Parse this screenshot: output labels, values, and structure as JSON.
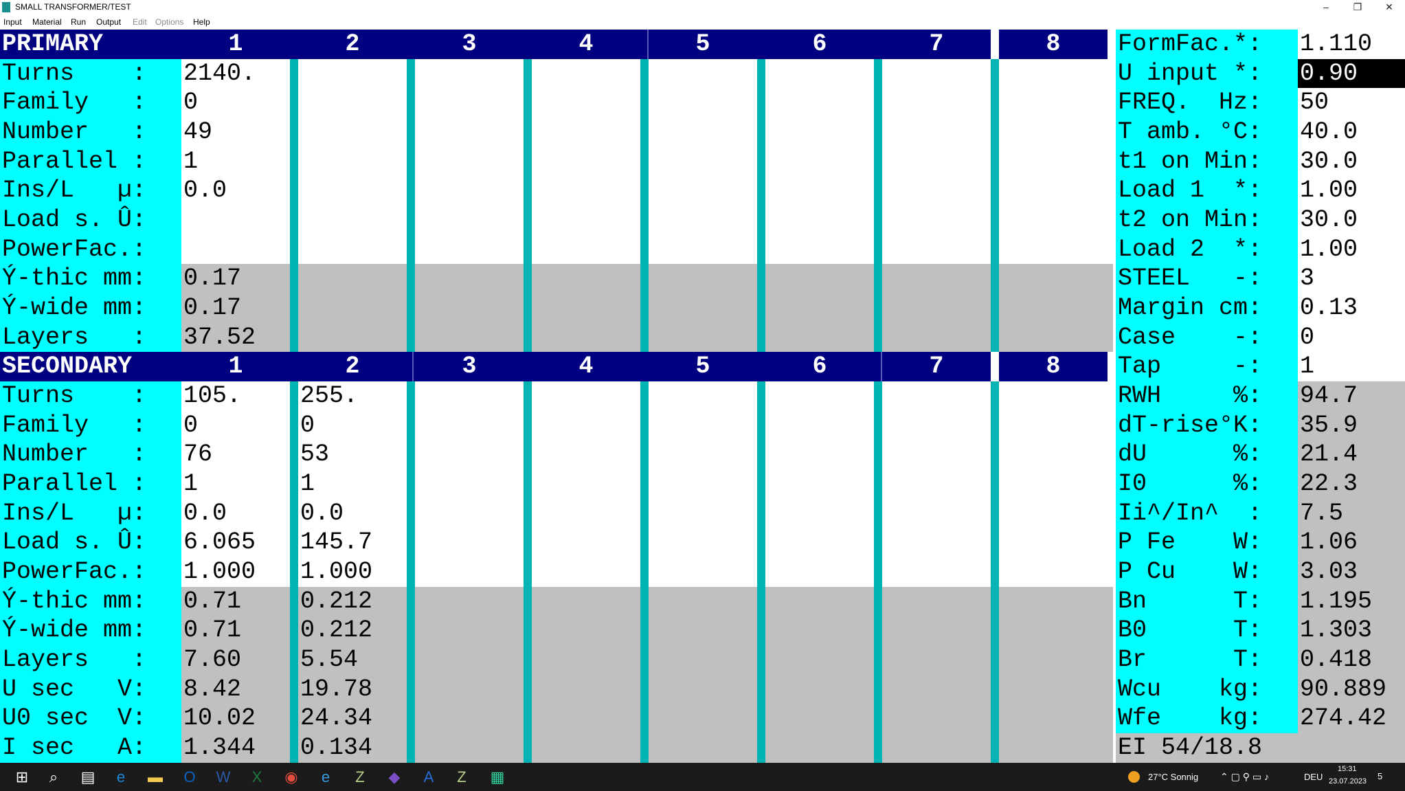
{
  "window": {
    "title": "SMALL TRANSFORMER/TEST",
    "minimize": "–",
    "maximize": "❐",
    "close": "✕"
  },
  "menu": [
    {
      "label": "Input",
      "enabled": true
    },
    {
      "label": "Material",
      "enabled": true
    },
    {
      "label": "Run",
      "enabled": true
    },
    {
      "label": "Output",
      "enabled": true
    },
    {
      "label": "Edit",
      "enabled": false
    },
    {
      "label": "Options",
      "enabled": false
    },
    {
      "label": "Help",
      "enabled": true
    }
  ],
  "primary": {
    "title": "PRIMARY",
    "columns": [
      "1",
      "2",
      "3",
      "4",
      "5",
      "6",
      "7",
      "8"
    ],
    "labels": [
      "Turns    :",
      "Family   :",
      "Number   :",
      "Parallel :",
      "Ins/L   µ:",
      "Load s. Û:",
      "PowerFac.:",
      "Ý-thic mm:",
      "Ý-wide mm:",
      "Layers   :"
    ],
    "values": [
      [
        "2140."
      ],
      [
        "0"
      ],
      [
        "49"
      ],
      [
        "1"
      ],
      [
        "0.0"
      ],
      [
        ""
      ],
      [
        ""
      ],
      [
        "0.17"
      ],
      [
        "0.17"
      ],
      [
        "37.52"
      ]
    ]
  },
  "secondary": {
    "title": "SECONDARY",
    "columns": [
      "1",
      "2",
      "3",
      "4",
      "5",
      "6",
      "7",
      "8"
    ],
    "labels": [
      "Turns    :",
      "Family   :",
      "Number   :",
      "Parallel :",
      "Ins/L   µ:",
      "Load s. Û:",
      "PowerFac.:",
      "Ý-thic mm:",
      "Ý-wide mm:",
      "Layers   :",
      "U sec   V:",
      "U0 sec  V:",
      "I sec   A:"
    ],
    "values": [
      [
        "105.",
        "255."
      ],
      [
        "0",
        "0"
      ],
      [
        "76",
        "53"
      ],
      [
        "1",
        "1"
      ],
      [
        "0.0",
        "0.0"
      ],
      [
        "6.065",
        "145.7"
      ],
      [
        "1.000",
        "1.000"
      ],
      [
        "0.71",
        "0.212"
      ],
      [
        "0.71",
        "0.212"
      ],
      [
        "7.60",
        "5.54"
      ],
      [
        "8.42",
        "19.78"
      ],
      [
        "10.02",
        "24.34"
      ],
      [
        "1.344",
        "0.134"
      ]
    ]
  },
  "params": [
    {
      "label": "FormFac.*:",
      "value": "1.110"
    },
    {
      "label": "U input *:",
      "value": "0.90"
    },
    {
      "label": "FREQ.  Hz:",
      "value": "50"
    },
    {
      "label": "T amb. °C:",
      "value": "40.0"
    },
    {
      "label": "t1 on Min:",
      "value": "30.0"
    },
    {
      "label": "Load 1  *:",
      "value": "1.00"
    },
    {
      "label": "t2 on Min:",
      "value": "30.0"
    },
    {
      "label": "Load 2  *:",
      "value": "1.00"
    },
    {
      "label": "STEEL   -:",
      "value": "3"
    },
    {
      "label": "Margin cm:",
      "value": "0.13"
    },
    {
      "label": "Case    -:",
      "value": "0"
    },
    {
      "label": "Tap     -:",
      "value": "1"
    }
  ],
  "results": [
    {
      "label": "RWH     %:",
      "value": "94.7"
    },
    {
      "label": "dT-rise°K:",
      "value": "35.9"
    },
    {
      "label": "dU      %:",
      "value": "21.4"
    },
    {
      "label": "I0      %:",
      "value": "22.3"
    },
    {
      "label": "Ii^/In^  :",
      "value": "7.5"
    },
    {
      "label": "P Fe    W:",
      "value": "1.06"
    },
    {
      "label": "P Cu    W:",
      "value": "3.03"
    },
    {
      "label": "Bn      T:",
      "value": "1.195"
    },
    {
      "label": "B0      T:",
      "value": "1.303"
    },
    {
      "label": "Br      T:",
      "value": "0.418"
    },
    {
      "label": "Wcu    kg:",
      "value": "90.889"
    },
    {
      "label": "Wfe    kg:",
      "value": "274.42"
    }
  ],
  "core": "EI 54/18.8",
  "taskbar": {
    "apps": [
      "windows-start",
      "search",
      "task-view",
      "edge",
      "file-explorer",
      "outlook",
      "word",
      "excel",
      "chrome",
      "internet-explorer",
      "z-app",
      "visual-studio",
      "a-app",
      "z-app-2",
      "calculator"
    ],
    "weather": "27°C  Sonnig",
    "lang": "DEU",
    "time": "15:31",
    "date": "23.07.2023",
    "notifications": "5"
  },
  "colors": {
    "header": "#000080",
    "label": "#00ffff",
    "separator": "#00b4b4",
    "gray": "#c0c0c0"
  }
}
